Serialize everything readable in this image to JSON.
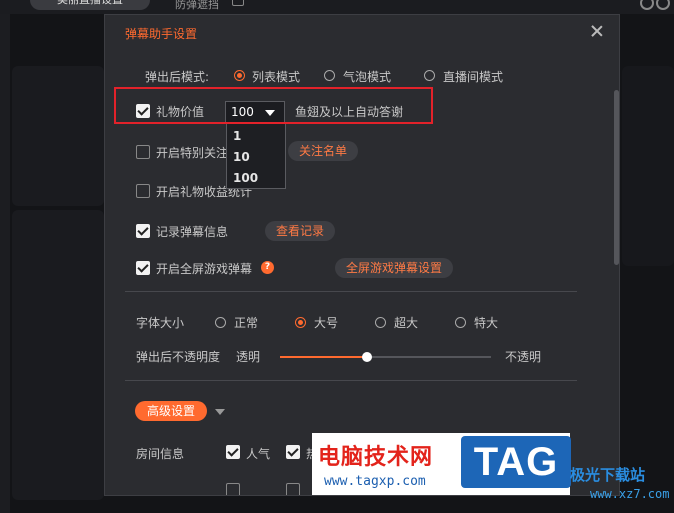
{
  "background": {
    "top_pill": "美丽直播设置",
    "top_text": "防弹遮挡"
  },
  "dialog": {
    "title": "弹幕助手设置",
    "popup_mode_label": "弹出后模式:",
    "popup_modes": [
      "列表模式",
      "气泡模式",
      "直播间模式"
    ],
    "popup_mode_selected": "列表模式",
    "gift_value_label": "礼物价值",
    "gift_value_checked": true,
    "gift_value_select": "100",
    "gift_value_options": [
      "1",
      "10",
      "100"
    ],
    "gift_value_suffix": "鱼翅及以上自动答谢",
    "special_follow_label": "开启特别关注",
    "special_follow_checked": false,
    "follow_list_button": "关注名单",
    "gift_stats_label": "开启礼物收益统计",
    "gift_stats_checked": false,
    "record_danmu_label": "记录弹幕信息",
    "record_danmu_checked": true,
    "view_records_button": "查看记录",
    "fullscreen_game_label": "开启全屏游戏弹幕",
    "fullscreen_game_checked": true,
    "help_icon": "?",
    "fullscreen_settings_button": "全屏游戏弹幕设置",
    "font_size_label": "字体大小",
    "font_sizes": [
      "正常",
      "大号",
      "超大",
      "特大"
    ],
    "font_size_selected": "大号",
    "opacity_label": "弹出后不透明度",
    "opacity_min_label": "透明",
    "opacity_max_label": "不透明",
    "opacity_level": 0.41,
    "advanced_button": "高级设置",
    "room_info_label": "房间信息",
    "room_info_items": [
      "人气",
      "热"
    ],
    "accent_color": "#ff6a2f"
  },
  "watermark": {
    "title": "电脑技术网",
    "url": "www.tagxp.com",
    "tag": "TAG",
    "site": "极光下载站",
    "site_url": "www.xz7.com"
  }
}
